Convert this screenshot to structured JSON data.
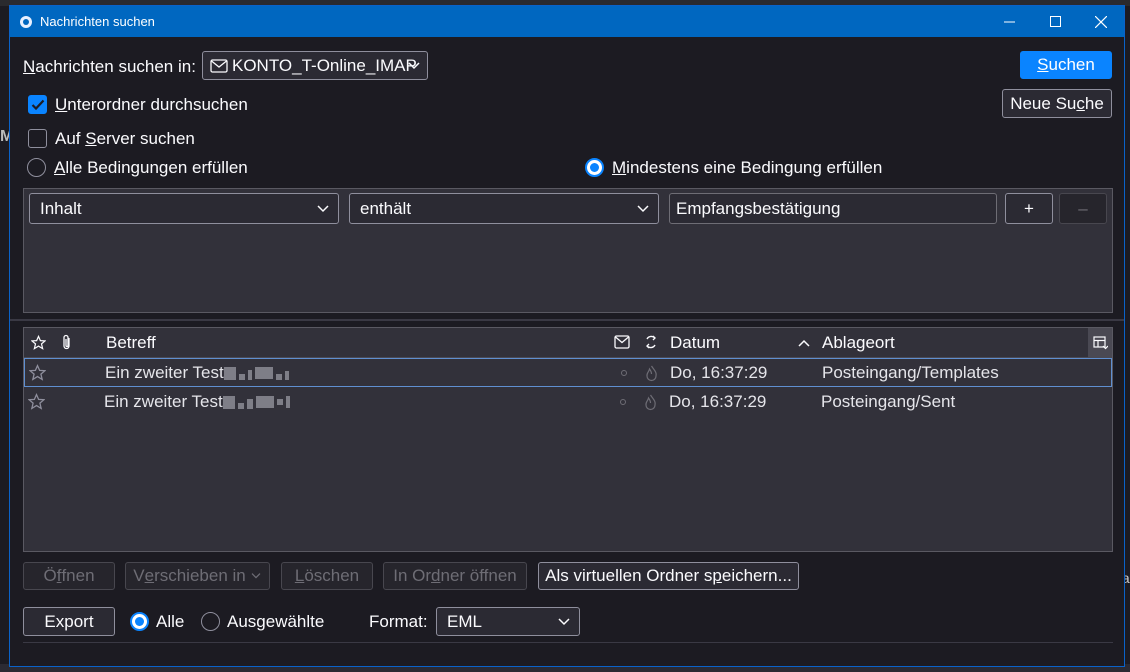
{
  "dialog": {
    "title": "Nachrichten suchen"
  },
  "search_in": {
    "label_accel": "N",
    "label_rest": "achrichten suchen in:",
    "account": "KONTO_T-Online_IMAP"
  },
  "options": {
    "subfolders_accel": "U",
    "subfolders_rest": "nterordner durchsuchen",
    "subfolders_checked": true,
    "server_pre": "Auf ",
    "server_accel": "S",
    "server_rest": "erver suchen",
    "server_checked": false
  },
  "match": {
    "all_accel": "A",
    "all_rest": "lle Bedingungen erfüllen",
    "any_accel": "M",
    "any_rest": "indestens eine Bedingung erfüllen",
    "selected": "any"
  },
  "buttons": {
    "search_accel": "S",
    "search_rest": "uchen",
    "new_search_pre": "Neue Su",
    "new_search_accel": "c",
    "new_search_rest": "he"
  },
  "rule": {
    "field": "Inhalt",
    "operator": "enthält",
    "value": "Empfangsbestätigung",
    "add": "+",
    "remove": "–"
  },
  "results": {
    "columns": {
      "subject": "Betreff",
      "date": "Datum",
      "location": "Ablageort"
    },
    "rows": [
      {
        "subject": "Ein zweiter Test",
        "date": "Do, 16:37:29",
        "location": "Posteingang/Templates"
      },
      {
        "subject": "Ein zweiter Test",
        "date": "Do, 16:37:29",
        "location": "Posteingang/Sent"
      }
    ]
  },
  "actions": {
    "open_pre": "Ö",
    "open_accel": "f",
    "open_rest": "fnen",
    "move_pre": "V",
    "move_accel": "e",
    "move_rest": "rschieben in",
    "delete_accel": "L",
    "delete_rest": "öschen",
    "open_folder_pre": "In Or",
    "open_folder_accel": "d",
    "open_folder_rest": "ner öffnen",
    "save_virtual_pre": "Als virtuellen Ordner s",
    "save_virtual_accel": "p",
    "save_virtual_rest": "eichern..."
  },
  "export": {
    "button": "Export",
    "all": "Alle",
    "selected_label": "Ausgewählte",
    "scope_selected": "all",
    "format_label": "Format:",
    "format_value": "EML"
  },
  "colors": {
    "accent": "#0a84ff",
    "titlebar": "#0067c0",
    "background": "#1c1b22",
    "panel": "#32313a"
  }
}
